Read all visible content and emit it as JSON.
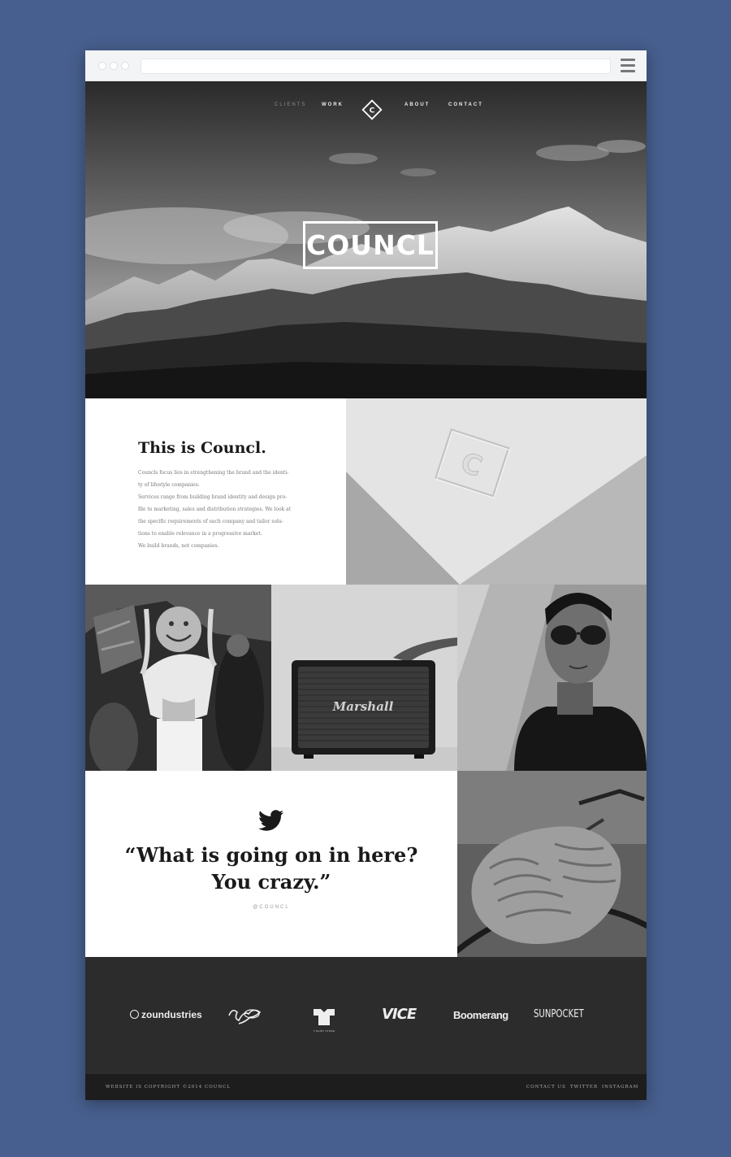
{
  "nav": {
    "left": [
      "CLIENTS",
      "WORK"
    ],
    "right": [
      "ABOUT",
      "CONTACT"
    ],
    "logo_letter": "C"
  },
  "hero": {
    "wordmark": "COUNCL"
  },
  "intro": {
    "title": "This is Councl.",
    "lines": [
      "Councls focus lies in strengthening the brand and the identi-",
      "ty of lifestyle companies.",
      "Services range from building brand identity and design pro-",
      "file to marketing, sales and distribution strategies. We look at",
      "the specific requirements of each company and tailor solu-",
      "tions to enable relevance in a progressive market.",
      "We build brands, not companies."
    ]
  },
  "gallery": {
    "speaker_brand": "Marshall",
    "emboss_letter": "C"
  },
  "quote": {
    "line1": "“What is going on in here?",
    "line2": "You crazy.”",
    "handle": "@COUNCL"
  },
  "clients": {
    "zound": "zoundustries",
    "tshirt": "T-SHIRT STORE",
    "vice": "VICE",
    "boomerang": "Boomerang",
    "sunpocket": "SUNPOCKET"
  },
  "footer": {
    "copyright": "WEBSITE IS COPYRIGHT ©2014 COUNCL",
    "links": [
      "CONTACT US",
      "TWITTER",
      "INSTAGRAM"
    ]
  },
  "colors": {
    "page_bg": "#475f8e",
    "dark_band": "#2c2c2c",
    "footer": "#1d1d1d"
  }
}
